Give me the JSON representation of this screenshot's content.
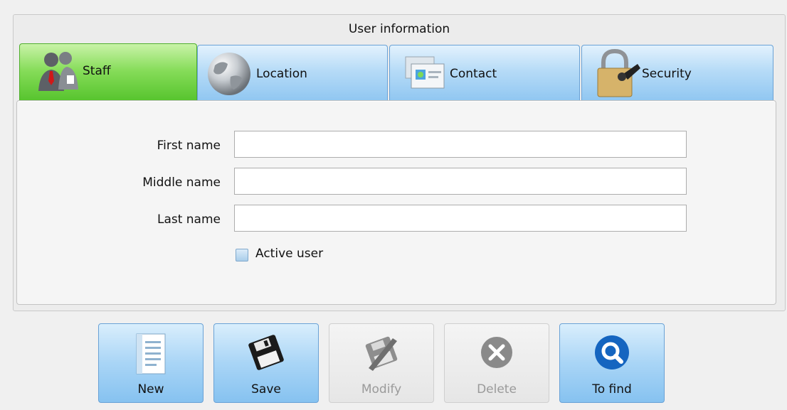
{
  "group": {
    "title": "User information"
  },
  "tabs": [
    {
      "label": "Staff",
      "icon": "staff-icon",
      "active": true
    },
    {
      "label": "Location",
      "icon": "globe-icon",
      "active": false
    },
    {
      "label": "Contact",
      "icon": "contact-card-icon",
      "active": false
    },
    {
      "label": "Security",
      "icon": "padlock-icon",
      "active": false
    }
  ],
  "form": {
    "first_name": {
      "label": "First name",
      "value": ""
    },
    "middle_name": {
      "label": "Middle name",
      "value": ""
    },
    "last_name": {
      "label": "Last name",
      "value": ""
    },
    "active_user": {
      "label": "Active user",
      "checked": false
    }
  },
  "buttons": {
    "new": {
      "label": "New",
      "icon": "document-icon",
      "enabled": true
    },
    "save": {
      "label": "Save",
      "icon": "floppy-disk-icon",
      "enabled": true
    },
    "modify": {
      "label": "Modify",
      "icon": "edit-icon",
      "enabled": false
    },
    "delete": {
      "label": "Delete",
      "icon": "delete-x-icon",
      "enabled": false
    },
    "find": {
      "label": "To find",
      "icon": "search-icon",
      "enabled": true
    }
  },
  "colors": {
    "active_tab": "#53c22a",
    "tab": "#8fc6f1",
    "button": "#86c2f0",
    "search_blue": "#1565c0"
  }
}
